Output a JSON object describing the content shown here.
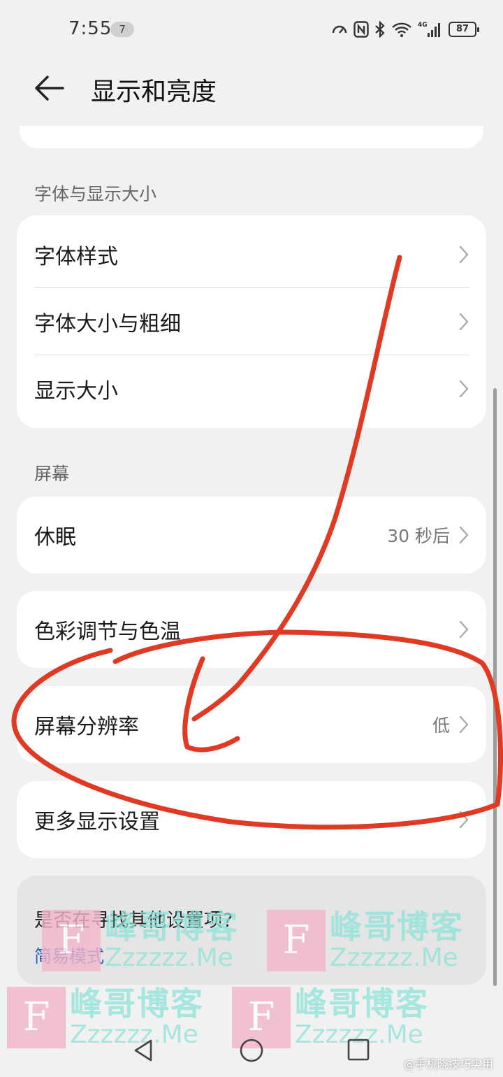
{
  "status_bar": {
    "time": "7:55",
    "notification_count": "7",
    "battery": "87",
    "network_label": "4G"
  },
  "header": {
    "title": "显示和亮度"
  },
  "sections": {
    "font": {
      "title": "字体与显示大小",
      "items": [
        {
          "label": "字体样式"
        },
        {
          "label": "字体大小与粗细"
        },
        {
          "label": "显示大小"
        }
      ]
    },
    "screen": {
      "title": "屏幕",
      "sleep": {
        "label": "休眠",
        "value": "30 秒后"
      },
      "color": {
        "label": "色彩调节与色温"
      },
      "resolution": {
        "label": "屏幕分辨率",
        "value": "低"
      },
      "more": {
        "label": "更多显示设置"
      }
    }
  },
  "search_card": {
    "question": "是否在寻找其他设置项?",
    "link": "简易模式"
  },
  "watermark": {
    "letter": "F",
    "cn": "峰哥博客",
    "en": "Zzzzzz.Me",
    "credit": "@手机晓技巧实用"
  },
  "colors": {
    "background": "#f1f1f1",
    "card": "#ffffff",
    "link": "#2c5fb8",
    "annotation": "#e03a24"
  }
}
